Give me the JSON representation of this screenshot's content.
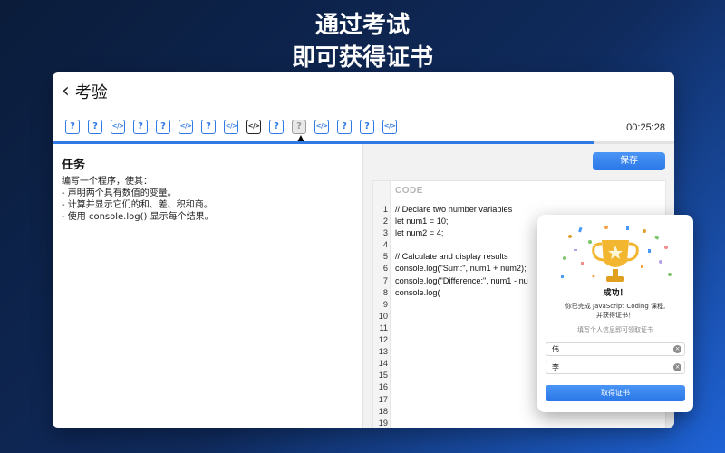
{
  "hero": {
    "line1": "通过考试",
    "line2": "即可获得证书"
  },
  "window": {
    "back_icon": "chevron-left-icon",
    "title": "考验"
  },
  "questions": [
    {
      "type": "question",
      "glyph": "?",
      "state": "normal"
    },
    {
      "type": "question",
      "glyph": "?",
      "state": "normal"
    },
    {
      "type": "code",
      "glyph": "</>",
      "state": "normal"
    },
    {
      "type": "question",
      "glyph": "?",
      "state": "normal"
    },
    {
      "type": "question",
      "glyph": "?",
      "state": "normal"
    },
    {
      "type": "code",
      "glyph": "</>",
      "state": "normal"
    },
    {
      "type": "question",
      "glyph": "?",
      "state": "normal"
    },
    {
      "type": "code",
      "glyph": "</>",
      "state": "normal"
    },
    {
      "type": "code",
      "glyph": "</>",
      "state": "current"
    },
    {
      "type": "question",
      "glyph": "?",
      "state": "normal"
    },
    {
      "type": "question",
      "glyph": "?",
      "state": "hover"
    },
    {
      "type": "code",
      "glyph": "</>",
      "state": "normal"
    },
    {
      "type": "question",
      "glyph": "?",
      "state": "normal"
    },
    {
      "type": "question",
      "glyph": "?",
      "state": "normal"
    },
    {
      "type": "code",
      "glyph": "</>",
      "state": "normal"
    }
  ],
  "timer": "00:25:28",
  "progress": 0.87,
  "task": {
    "title": "任务",
    "lines": [
      "编写一个程序，使其：",
      "- 声明两个具有数值的变量。",
      "- 计算并显示它们的和、差、积和商。",
      "- 使用 console.log() 显示每个结果。"
    ]
  },
  "editor": {
    "save_label": "保存",
    "code_label": "CODE",
    "lines": [
      "// Declare two number variables",
      "let num1 = 10;",
      "let num2 = 4;",
      "",
      "// Calculate and display results",
      "console.log(\"Sum:\", num1 + num2);",
      "console.log(\"Difference:\", num1 - nu",
      "console.log(",
      "",
      "",
      "",
      "",
      "",
      "",
      "",
      "",
      "",
      "",
      ""
    ]
  },
  "modal": {
    "icon": "trophy-icon",
    "title": "成功！",
    "message_line1": "你已完成 JavaScript Coding 课程,",
    "message_line2": "并获得证书！",
    "hint": "填写个人信息即可领取证书",
    "first_name": "伟",
    "last_name": "李",
    "button_label": "取得证书",
    "colors": {
      "accent": "#2a77e8",
      "trophy": "#f2b630"
    }
  }
}
